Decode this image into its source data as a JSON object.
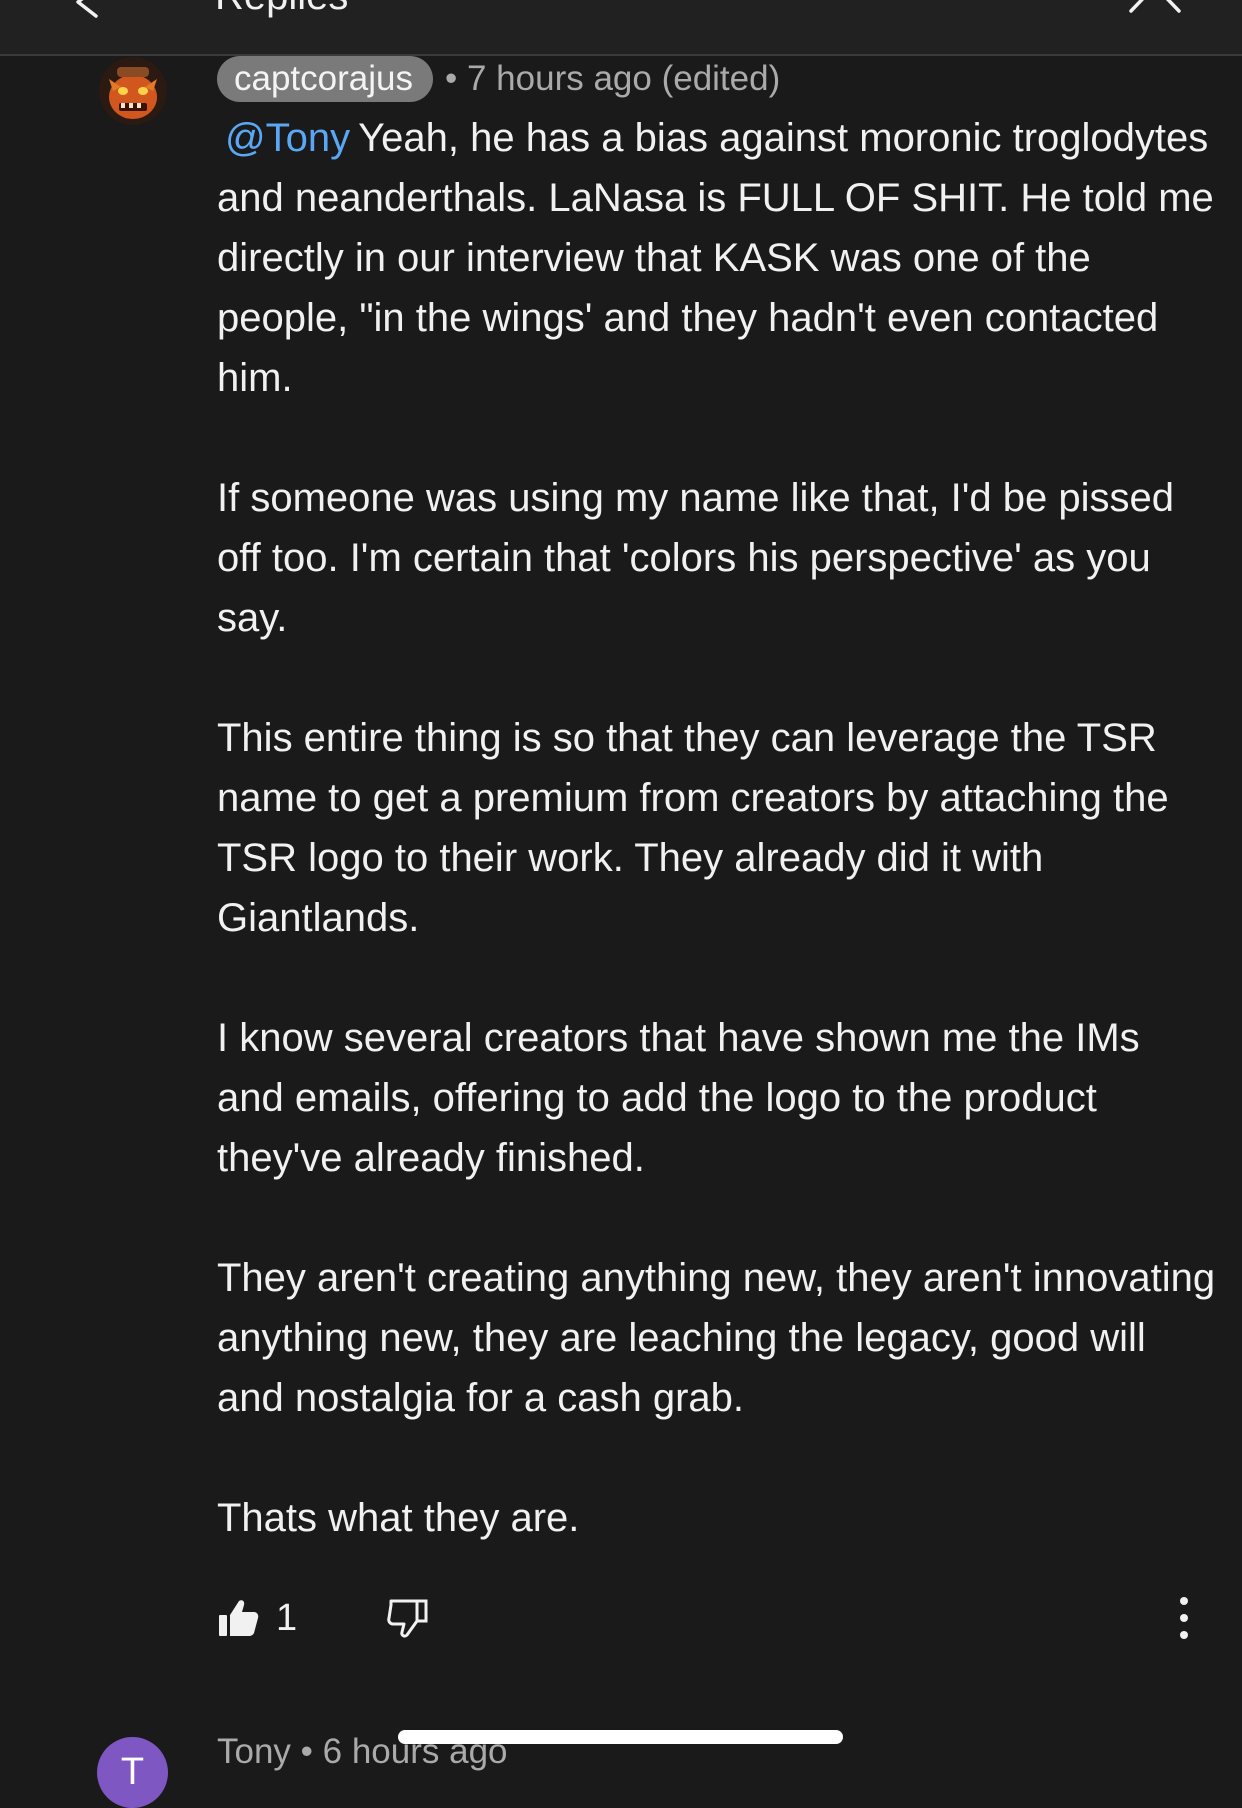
{
  "topbar": {
    "title_stub": "Replies"
  },
  "comment": {
    "author": "captcorajus",
    "separator": "•",
    "timestamp": "7 hours ago (edited)",
    "mention": "@Tony",
    "paragraph_1_rest": "Yeah, he has a bias against moronic troglodytes and neanderthals. LaNasa is FULL OF SHIT. He told me directly in our interview that KASK was one of the people, \"in the wings' and they hadn't even contacted him.",
    "paragraph_2": "If someone was using my name like that, I'd be pissed off too. I'm certain that 'colors his perspective' as you say.",
    "paragraph_3": "This entire thing is so that they can leverage the TSR name to get a premium from creators by attaching the TSR logo to their work. They already did it with Giantlands.",
    "paragraph_4": "I know several creators that have shown me the IMs and emails, offering to add the logo to the product they've already finished.",
    "paragraph_5": "They aren't creating anything new, they aren't innovating anything new, they are leaching the legacy, good will and nostalgia for a cash grab.",
    "paragraph_6": "Thats what they are.",
    "like_count": "1"
  },
  "next_comment": {
    "avatar_letter": "T",
    "header": "Tony • 6 hours ago"
  },
  "colors": {
    "background": "#1a1a1a",
    "mention": "#5aa7f5",
    "author_chip": "#7a7a7a",
    "meta_text": "#aaaaaa",
    "next_avatar": "#7e57c2"
  },
  "icons": {
    "back": "back-arrow-icon",
    "close": "close-icon",
    "like": "thumbs-up-filled-icon",
    "dislike": "thumbs-down-outline-icon",
    "more": "more-vertical-icon"
  }
}
